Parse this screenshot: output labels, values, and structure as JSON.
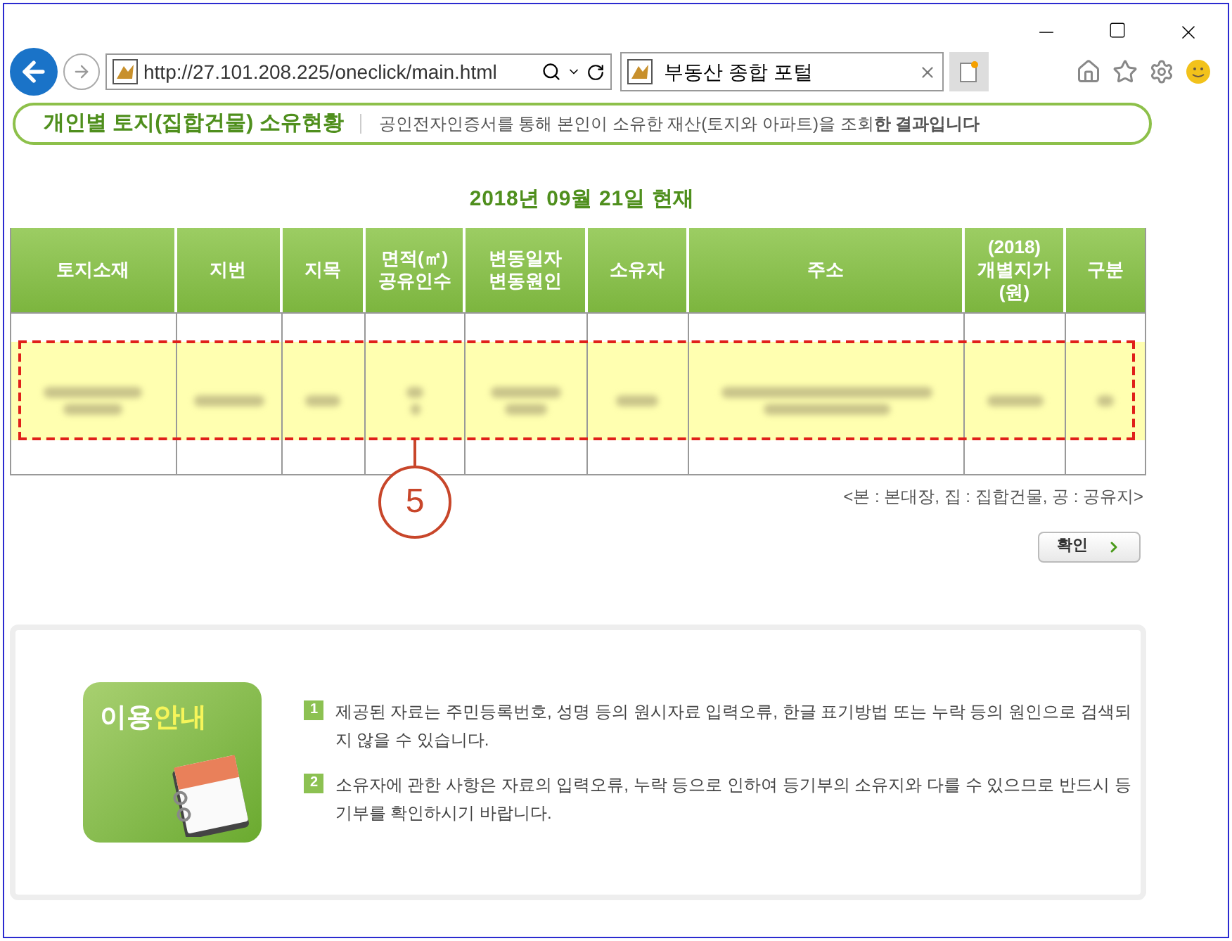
{
  "browser": {
    "address": "http://27.101.208.225/oneclick/main.html",
    "tab_title": "부동산 종합 포털"
  },
  "header": {
    "title": "개인별 토지(집합건물) 소유현황",
    "subtitle": "공인전자인증서를 통해 본인이 소유한 재산(토지와 아파트)을 조회**한 결과입니다**"
  },
  "date_title": "2018년 09월 21일 현재",
  "table": {
    "columns": [
      [
        "토지소재"
      ],
      [
        "지번"
      ],
      [
        "지목"
      ],
      [
        "면적(㎡)",
        "공유인수"
      ],
      [
        "변동일자",
        "변동원인"
      ],
      [
        "소유자"
      ],
      [
        "주소"
      ],
      [
        "(2018)",
        "개별지가",
        "(원)"
      ],
      [
        "구분"
      ]
    ]
  },
  "callout": "5",
  "legend": "<본 : 본대장, 집 : 집합건물, 공 : 공유지>",
  "confirm_button": "확인",
  "guide": {
    "title_parts": [
      "이용",
      "안내"
    ],
    "notes": [
      {
        "number": "1",
        "text": "제공된 자료는 주민등록번호, 성명 등의 원시자료 입력오류, 한글 표기방법 또는 누락 등의 원인으로 검색되지 않을 수 있습니다."
      },
      {
        "number": "2",
        "text": "소유자에 관한 사항은 자료의 입력오류, 누락 등으로 인하여 등기부의 소유지와 다를 수 있으므로 반드시 등기부를 확인하시기 바랍니다."
      }
    ]
  }
}
